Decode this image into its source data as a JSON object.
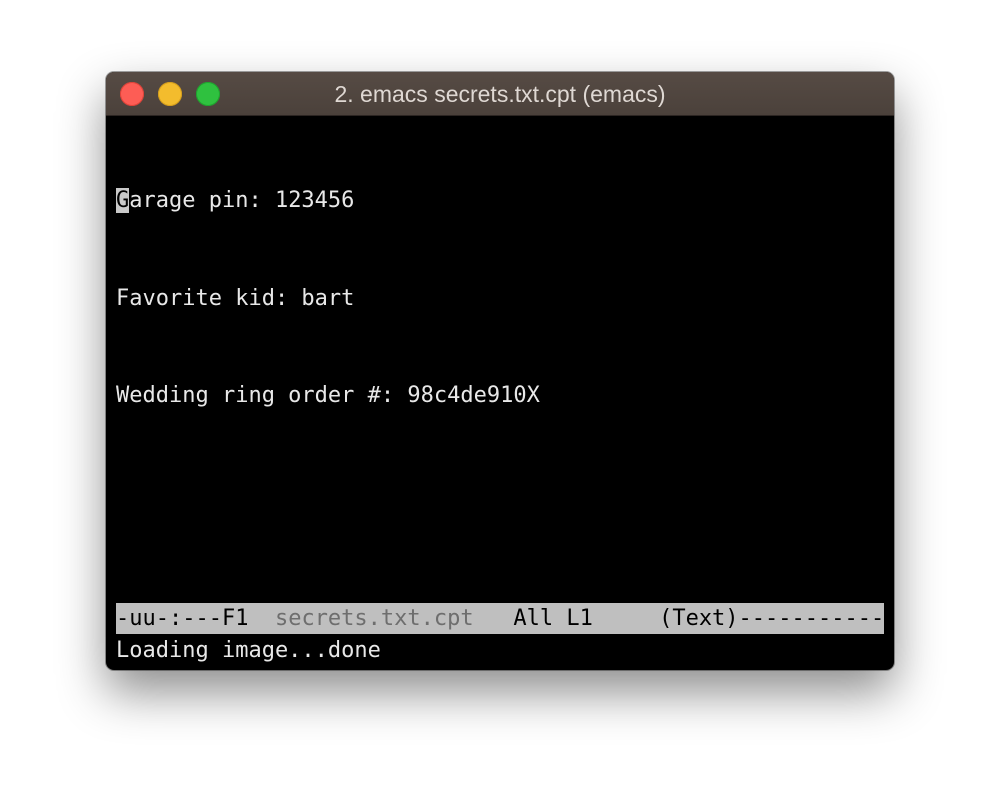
{
  "window": {
    "title": "2. emacs secrets.txt.cpt (emacs)",
    "controls": {
      "close_color": "#fd5d55",
      "minimize_color": "#f3bc2d",
      "zoom_color": "#2fc13f"
    }
  },
  "buffer": {
    "cursor_char": "G",
    "lines": [
      "arage pin: 123456",
      "Favorite kid: bart",
      "Wedding ring order #: 98c4de910X"
    ]
  },
  "modeline": {
    "status": "-uu-:---F1  ",
    "buffer_name": "secrets.txt.cpt",
    "position": "   All L1     ",
    "mode": "(Text)-----------"
  },
  "echo_area": {
    "message": "Loading image...done"
  }
}
